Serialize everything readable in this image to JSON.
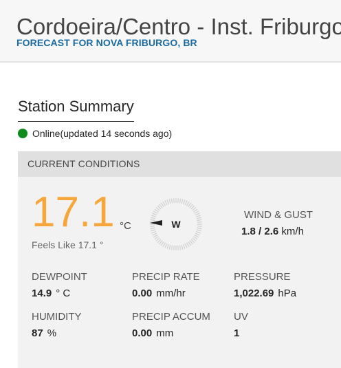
{
  "header": {
    "station_name": "Cordoeira/Centro - Inst. Friburgo",
    "forecast_link": "FORECAST FOR NOVA FRIBURGO, BR"
  },
  "summary": {
    "title": "Station Summary",
    "status_text": "Online(updated 14 seconds ago)",
    "status_color": "#0f8a1c"
  },
  "conditions": {
    "title": "CURRENT CONDITIONS",
    "temperature": "17.1",
    "temperature_unit": "°C",
    "feels_like": "Feels Like 17.1 °",
    "wind_direction": "W",
    "wind_label": "WIND & GUST",
    "wind_speed": "1.8",
    "wind_separator": " / ",
    "wind_gust": "2.6",
    "wind_unit": " km/h",
    "metrics": {
      "dewpoint": {
        "label": "DEWPOINT",
        "value": "14.9",
        "unit": "° C"
      },
      "precip_rate": {
        "label": "PRECIP RATE",
        "value": "0.00",
        "unit": "mm/hr"
      },
      "pressure": {
        "label": "PRESSURE",
        "value": "1,022.69",
        "unit": "hPa"
      },
      "humidity": {
        "label": "HUMIDITY",
        "value": "87",
        "unit": "%"
      },
      "precip_accum": {
        "label": "PRECIP ACCUM",
        "value": "0.00",
        "unit": "mm"
      },
      "uv": {
        "label": "UV",
        "value": "1",
        "unit": ""
      }
    }
  },
  "colors": {
    "temperature": "#f6a63b",
    "link": "#1a6aa0",
    "panel_bg": "#f2f2f2",
    "panel_header": "#e0e0e0"
  }
}
